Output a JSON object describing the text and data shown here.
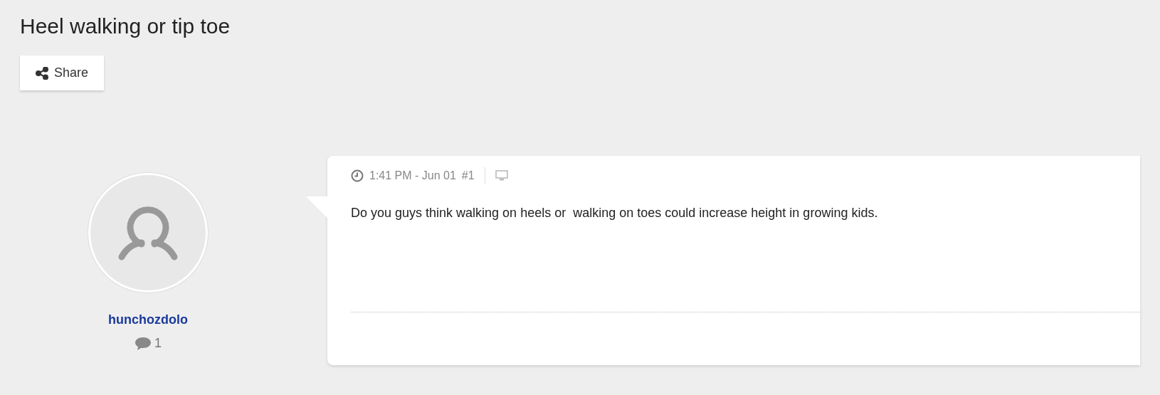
{
  "thread": {
    "title": "Heel walking or tip toe",
    "share_button": "Share"
  },
  "posts": [
    {
      "author": "hunchozdolo",
      "author_post_count": "1",
      "time": "1:41 PM - Jun 01",
      "number": "#1",
      "body": "Do you guys think walking on heels or  walking on toes could increase height in growing kids."
    }
  ]
}
